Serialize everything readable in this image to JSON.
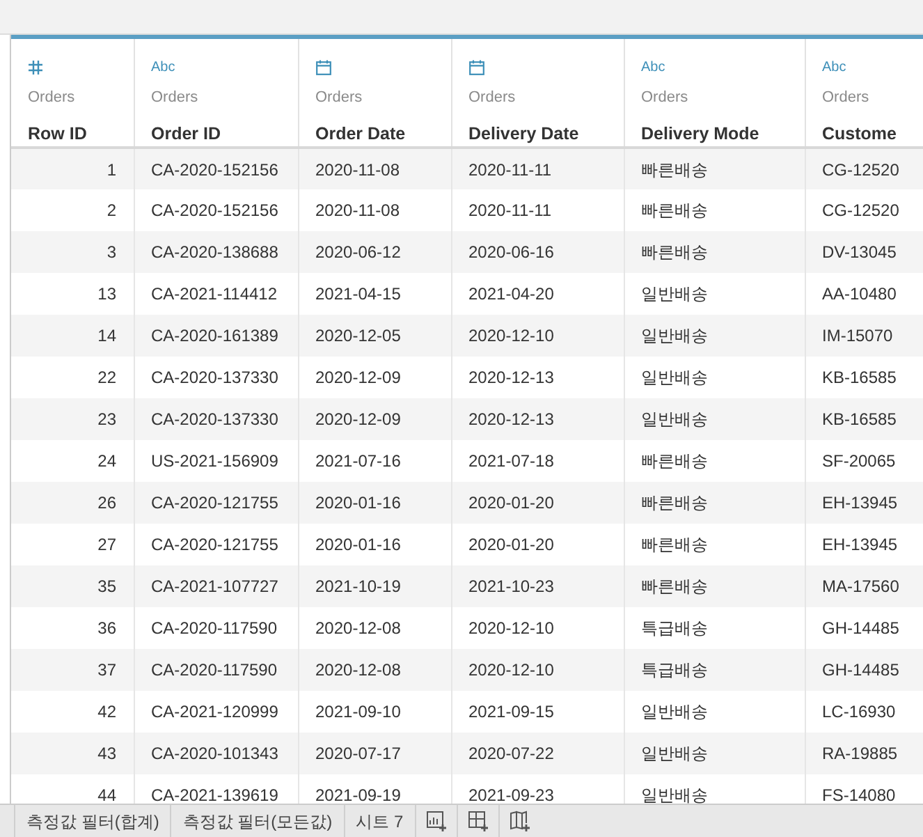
{
  "table": {
    "columns": [
      {
        "kind": "number",
        "source": "Orders",
        "name": "Row ID"
      },
      {
        "kind": "string",
        "type_label": "Abc",
        "source": "Orders",
        "name": "Order ID"
      },
      {
        "kind": "date",
        "source": "Orders",
        "name": "Order Date"
      },
      {
        "kind": "date",
        "source": "Orders",
        "name": "Delivery Date"
      },
      {
        "kind": "string",
        "type_label": "Abc",
        "source": "Orders",
        "name": "Delivery Mode"
      },
      {
        "kind": "string",
        "type_label": "Abc",
        "source": "Orders",
        "name": "Custome"
      }
    ],
    "rows": [
      [
        "1",
        "CA-2020-152156",
        "2020-11-08",
        "2020-11-11",
        "빠른배송",
        "CG-12520"
      ],
      [
        "2",
        "CA-2020-152156",
        "2020-11-08",
        "2020-11-11",
        "빠른배송",
        "CG-12520"
      ],
      [
        "3",
        "CA-2020-138688",
        "2020-06-12",
        "2020-06-16",
        "빠른배송",
        "DV-13045"
      ],
      [
        "13",
        "CA-2021-114412",
        "2021-04-15",
        "2021-04-20",
        "일반배송",
        "AA-10480"
      ],
      [
        "14",
        "CA-2020-161389",
        "2020-12-05",
        "2020-12-10",
        "일반배송",
        "IM-15070"
      ],
      [
        "22",
        "CA-2020-137330",
        "2020-12-09",
        "2020-12-13",
        "일반배송",
        "KB-16585"
      ],
      [
        "23",
        "CA-2020-137330",
        "2020-12-09",
        "2020-12-13",
        "일반배송",
        "KB-16585"
      ],
      [
        "24",
        "US-2021-156909",
        "2021-07-16",
        "2021-07-18",
        "빠른배송",
        "SF-20065"
      ],
      [
        "26",
        "CA-2020-121755",
        "2020-01-16",
        "2020-01-20",
        "빠른배송",
        "EH-13945"
      ],
      [
        "27",
        "CA-2020-121755",
        "2020-01-16",
        "2020-01-20",
        "빠른배송",
        "EH-13945"
      ],
      [
        "35",
        "CA-2021-107727",
        "2021-10-19",
        "2021-10-23",
        "빠른배송",
        "MA-17560"
      ],
      [
        "36",
        "CA-2020-117590",
        "2020-12-08",
        "2020-12-10",
        "특급배송",
        "GH-14485"
      ],
      [
        "37",
        "CA-2020-117590",
        "2020-12-08",
        "2020-12-10",
        "특급배송",
        "GH-14485"
      ],
      [
        "42",
        "CA-2021-120999",
        "2021-09-10",
        "2021-09-15",
        "일반배송",
        "LC-16930"
      ],
      [
        "43",
        "CA-2020-101343",
        "2020-07-17",
        "2020-07-22",
        "일반배송",
        "RA-19885"
      ],
      [
        "44",
        "CA-2021-139619",
        "2021-09-19",
        "2021-09-23",
        "일반배송",
        "FS-14080"
      ]
    ]
  },
  "sheet_tabs": [
    {
      "label": "측정값 필터(합계)"
    },
    {
      "label": "측정값 필터(모든값)"
    },
    {
      "label": "시트 7"
    }
  ]
}
